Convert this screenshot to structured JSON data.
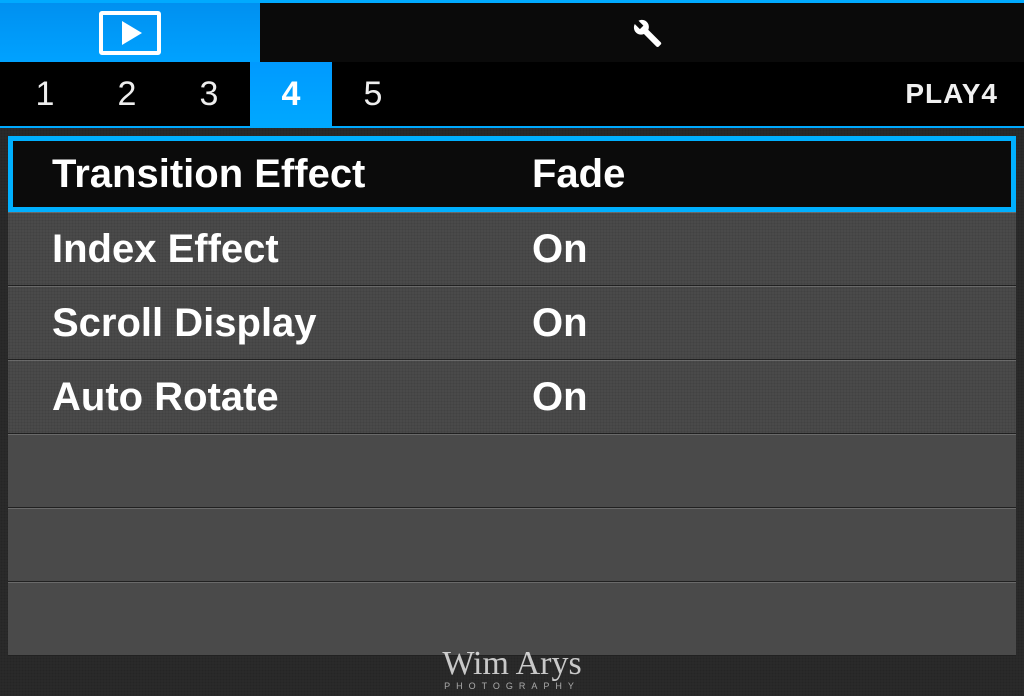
{
  "topTabs": {
    "playback": "Playback",
    "setup": "Setup"
  },
  "pageTabs": {
    "pages": [
      "1",
      "2",
      "3",
      "4",
      "5"
    ],
    "active": "4",
    "label": "PLAY4"
  },
  "menu": {
    "rows": [
      {
        "label": "Transition Effect",
        "value": "Fade",
        "selected": true
      },
      {
        "label": "Index Effect",
        "value": "On",
        "selected": false
      },
      {
        "label": "Scroll Display",
        "value": "On",
        "selected": false
      },
      {
        "label": "Auto Rotate",
        "value": "On",
        "selected": false
      }
    ],
    "emptyRows": 3
  },
  "watermark": {
    "name": "Wim Arys",
    "sub": "PHOTOGRAPHY"
  }
}
